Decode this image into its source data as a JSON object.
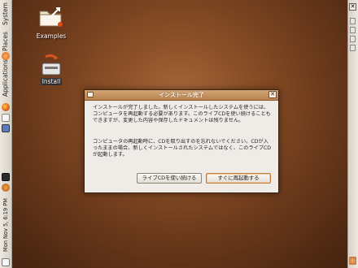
{
  "panel": {
    "menu_system": "System",
    "menu_places": "Places",
    "menu_applications": "Applications",
    "clock": "Mon Nov 5,  6:19 PM"
  },
  "desktop": {
    "icons": [
      {
        "label": "Examples",
        "icon": "folder-examples-icon"
      },
      {
        "label": "Install",
        "icon": "install-icon"
      }
    ]
  },
  "dialog": {
    "title": "インストール完了",
    "message_1": "インストールが完了しました。新しくインストールしたシステムを使うには、コンピュータを再起動する必要があります。このライブCDを使い続けることもできますが、変更した内容や保存したドキュメントは残りません。",
    "message_2": "コンピュータの再起動時に、CDを取り出すのを忘れないでください。CDが入ったままの場合、新しくインストールされたシステムではなく、このライブCDが起動します。",
    "continue_button": "ライブCDを使い続ける",
    "restart_button": "すぐに再起動する"
  },
  "colors": {
    "desktop_brown": "#8a4f27",
    "titlebar": "#c08a56",
    "dialog_bg": "#efebe7"
  }
}
